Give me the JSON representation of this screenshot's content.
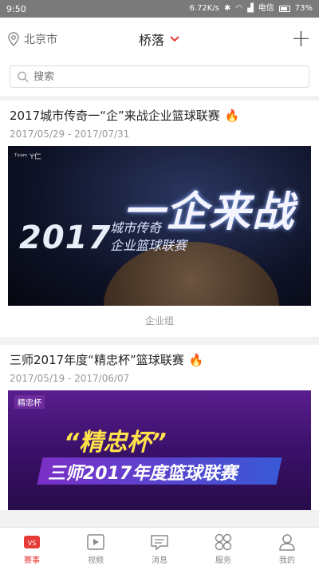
{
  "status_bar": {
    "time": "9:50",
    "network": "6.72K/s",
    "carrier": "电信",
    "battery": "73%"
  },
  "top_nav": {
    "location": "北京市",
    "area": "桥落"
  },
  "search": {
    "placeholder": "搜索"
  },
  "cards": [
    {
      "title": "2017城市传奇一“企”来战企业篮球联赛",
      "date": "2017/05/29 - 2017/07/31",
      "banner_logo": "ᵀᵉᵃᵐ Y仁",
      "banner_year": "2017",
      "banner_big": "一企来战",
      "banner_sub_1": "城市传奇",
      "banner_sub_2": "企业篮球联赛",
      "tag": "企业组"
    },
    {
      "title": "三师2017年度“精忠杯”篮球联赛",
      "date": "2017/05/19 - 2017/06/07",
      "banner_logo": "精忠杯",
      "banner_big": "“精忠杯”",
      "banner_sub": "三师2017年度篮球联赛"
    }
  ],
  "tabs": [
    {
      "label": "赛事",
      "icon": "trophy-icon",
      "active": true
    },
    {
      "label": "视频",
      "icon": "play-icon",
      "active": false
    },
    {
      "label": "消息",
      "icon": "message-icon",
      "active": false
    },
    {
      "label": "服务",
      "icon": "service-icon",
      "active": false
    },
    {
      "label": "我的",
      "icon": "user-icon",
      "active": false
    }
  ],
  "colors": {
    "accent": "#e63a36",
    "status_bar": "#7a7a7a"
  }
}
